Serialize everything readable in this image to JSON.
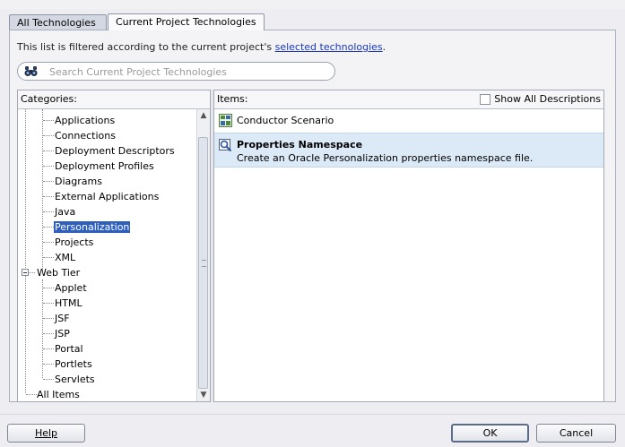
{
  "tabs": [
    {
      "label": "All Technologies",
      "active": false
    },
    {
      "label": "Current Project Technologies",
      "active": true
    }
  ],
  "filter": {
    "prefix": "This list is filtered according to the current project's ",
    "link": "selected technologies",
    "suffix": "."
  },
  "search": {
    "placeholder": "Search Current Project Technologies",
    "value": "",
    "icon": "binoculars-icon"
  },
  "categories": {
    "header": "Categories:",
    "items": [
      {
        "label": "Applications",
        "level": 2
      },
      {
        "label": "Connections",
        "level": 2
      },
      {
        "label": "Deployment Descriptors",
        "level": 2
      },
      {
        "label": "Deployment Profiles",
        "level": 2
      },
      {
        "label": "Diagrams",
        "level": 2
      },
      {
        "label": "External Applications",
        "level": 2
      },
      {
        "label": "Java",
        "level": 2
      },
      {
        "label": "Personalization",
        "level": 2,
        "selected": true
      },
      {
        "label": "Projects",
        "level": 2
      },
      {
        "label": "XML",
        "level": 2
      },
      {
        "label": "Web Tier",
        "level": 1,
        "expanded": true
      },
      {
        "label": "Applet",
        "level": 2
      },
      {
        "label": "HTML",
        "level": 2
      },
      {
        "label": "JSF",
        "level": 2
      },
      {
        "label": "JSP",
        "level": 2
      },
      {
        "label": "Portal",
        "level": 2
      },
      {
        "label": "Portlets",
        "level": 2
      },
      {
        "label": "Servlets",
        "level": 2
      },
      {
        "label": "All Items",
        "level": 1
      }
    ]
  },
  "items_pane": {
    "header": "Items:",
    "show_all_label": "Show All Descriptions",
    "show_all_checked": false,
    "items": [
      {
        "name": "Conductor Scenario",
        "description": "",
        "icon": "conductor-scenario-icon"
      },
      {
        "name": "Properties Namespace",
        "description": "Create an Oracle Personalization properties namespace file.",
        "icon": "properties-namespace-icon",
        "selected": true
      }
    ]
  },
  "buttons": {
    "help": "Help",
    "ok": "OK",
    "cancel": "Cancel"
  },
  "colors": {
    "selection": "#2f5fbd",
    "item_selected": "#dce9f6",
    "link": "#1a38b8"
  }
}
